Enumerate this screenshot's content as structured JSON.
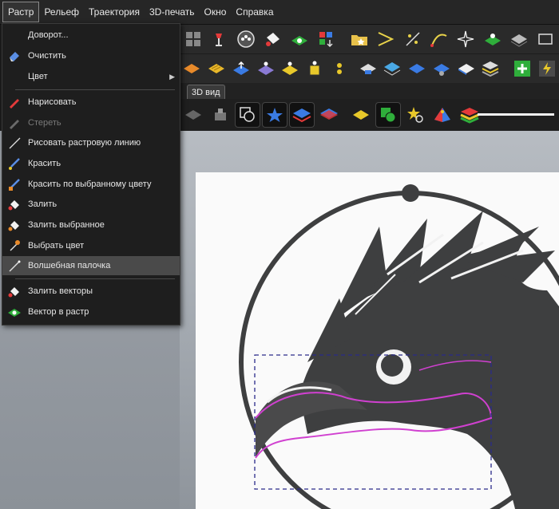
{
  "menubar": {
    "items": [
      "Растр",
      "Рельеф",
      "Траектория",
      "3D-печать",
      "Окно",
      "Справка"
    ]
  },
  "tab": {
    "label": "3D вид"
  },
  "raster_menu": {
    "items": [
      {
        "label": "Доворот...",
        "icon": "rotate-icon"
      },
      {
        "label": "Очистить",
        "icon": "eraser-icon"
      },
      {
        "label": "Цвет",
        "icon": "none",
        "submenu": "▶"
      },
      {
        "label": "Нарисовать",
        "icon": "red-pencil-icon"
      },
      {
        "label": "Стереть",
        "icon": "gray-pencil-icon",
        "disabled": true
      },
      {
        "label": "Рисовать растровую линию",
        "icon": "line-icon"
      },
      {
        "label": "Красить",
        "icon": "brush-icon"
      },
      {
        "label": "Красить по выбранному цвету",
        "icon": "brush-color-icon"
      },
      {
        "label": "Залить",
        "icon": "fill-bucket-icon"
      },
      {
        "label": "Залить выбранное",
        "icon": "fill-selected-icon"
      },
      {
        "label": "Выбрать цвет",
        "icon": "eyedropper-icon"
      },
      {
        "label": "Волшебная палочка",
        "icon": "magic-wand-icon",
        "highlighted": true
      },
      {
        "label": "Залить векторы",
        "icon": "fill-vectors-icon"
      },
      {
        "label": "Вектор в растр",
        "icon": "vector-to-raster-icon"
      }
    ]
  },
  "colors": {
    "menu_bg": "#1e1e1e",
    "highlight": "#4a4a4a",
    "selection_dash": "#2a2a8a",
    "magic_edge": "#d040d0",
    "eagle": "#3e3f40"
  }
}
